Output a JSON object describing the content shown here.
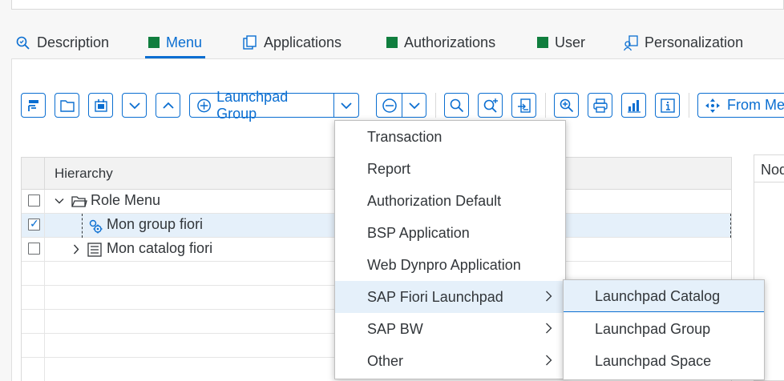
{
  "tabs": [
    {
      "label": "Description",
      "icon": "description-icon"
    },
    {
      "label": "Menu",
      "icon": "green-status-square"
    },
    {
      "label": "Applications",
      "icon": "applications-icon"
    },
    {
      "label": "Authorizations",
      "icon": "green-status-square"
    },
    {
      "label": "User",
      "icon": "green-status-square"
    },
    {
      "label": "Personalization",
      "icon": "personalization-icon"
    }
  ],
  "toolbar": {
    "launchpad_group_label": "Launchpad Group",
    "from_menu_label": "From Menu"
  },
  "grid": {
    "header": "Hierarchy",
    "rows": [
      {
        "label": "Role Menu",
        "checked": false
      },
      {
        "label": "Mon group fiori",
        "checked": true
      },
      {
        "label": "Mon catalog fiori",
        "checked": false
      }
    ]
  },
  "right_panel": {
    "header": "Node"
  },
  "menu": {
    "items": [
      {
        "label": "Transaction"
      },
      {
        "label": "Report"
      },
      {
        "label": "Authorization Default"
      },
      {
        "label": "BSP Application"
      },
      {
        "label": "Web Dynpro Application"
      },
      {
        "label": "SAP Fiori Launchpad"
      },
      {
        "label": "SAP BW"
      },
      {
        "label": "Other"
      }
    ]
  },
  "submenu": {
    "items": [
      {
        "label": "Launchpad Catalog"
      },
      {
        "label": "Launchpad Group"
      },
      {
        "label": "Launchpad Space"
      }
    ]
  },
  "colors": {
    "accent": "#0a6ed1",
    "status_green": "#107e3e",
    "selection": "#e5f0fa"
  }
}
